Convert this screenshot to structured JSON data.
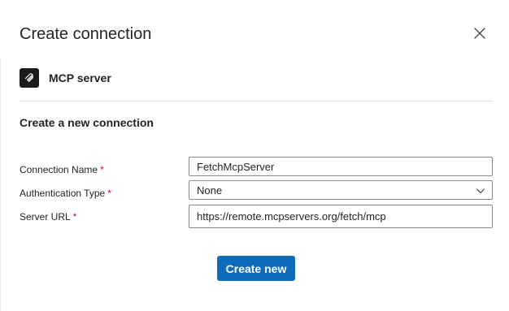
{
  "dialog": {
    "title": "Create connection",
    "close_icon": "close-icon"
  },
  "connector": {
    "icon": "mcp-server-icon",
    "name": "MCP server"
  },
  "form": {
    "section_title": "Create a new connection",
    "required_marker": "*",
    "fields": [
      {
        "label": "Connection Name",
        "value": "FetchMcpServer",
        "required": true
      },
      {
        "label": "Authentication Type",
        "value": "None",
        "required": true
      },
      {
        "label": "Server URL",
        "value": "https://remote.mcpservers.org/fetch/mcp",
        "required": true
      }
    ],
    "submit_label": "Create new"
  },
  "colors": {
    "primary": "#0f6cbd",
    "required": "#c50f1f",
    "text": "#242424",
    "icon_tile": "#1b1b1b"
  }
}
